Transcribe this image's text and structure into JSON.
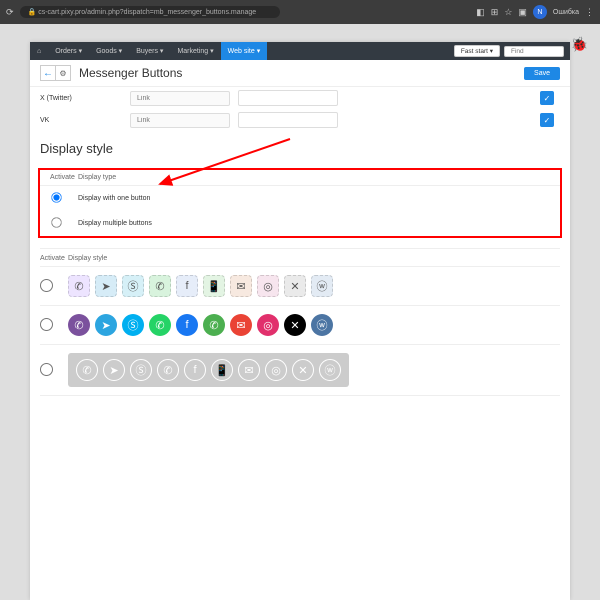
{
  "browser": {
    "url": "cs-cart.pixy.pro/admin.php?dispatch=mb_messenger_buttons.manage",
    "right_label": "Ошибка",
    "badge": "N"
  },
  "nav": {
    "items": [
      "Orders ▾",
      "Goods ▾",
      "Buyers ▾",
      "Marketing ▾",
      "Web site ▾"
    ],
    "fast_start": "Fast start ▾",
    "search_placeholder": "Find"
  },
  "header": {
    "title": "Messenger Buttons",
    "save": "Save"
  },
  "rows": [
    {
      "label": "X (Twitter)",
      "placeholder": "Link"
    },
    {
      "label": "VK",
      "placeholder": "Link"
    }
  ],
  "section": "Display style",
  "tbl": {
    "col1": "Activate",
    "col2": "Display type"
  },
  "options": [
    {
      "label": "Display with one button",
      "checked": true
    },
    {
      "label": "Display multiple buttons",
      "checked": false
    }
  ],
  "style_tbl": {
    "col1": "Activate",
    "col2": "Display style"
  },
  "icon_row1": [
    {
      "bg": "#ede4ff",
      "sym": "✆"
    },
    {
      "bg": "#d6ecf7",
      "sym": "➤"
    },
    {
      "bg": "#d6f0f7",
      "sym": "Ⓢ"
    },
    {
      "bg": "#d8f3dd",
      "sym": "✆"
    },
    {
      "bg": "#e6edf9",
      "sym": "f"
    },
    {
      "bg": "#e3f4e3",
      "sym": "📱"
    },
    {
      "bg": "#f7e9e0",
      "sym": "✉"
    },
    {
      "bg": "#f7e5ee",
      "sym": "◎"
    },
    {
      "bg": "#eaeaea",
      "sym": "✕"
    },
    {
      "bg": "#e3ebf4",
      "sym": "ⓦ"
    }
  ],
  "icon_row2": [
    {
      "bg": "#7b519d",
      "sym": "✆"
    },
    {
      "bg": "#2ca5e0",
      "sym": "➤"
    },
    {
      "bg": "#00aff0",
      "sym": "Ⓢ"
    },
    {
      "bg": "#25d366",
      "sym": "✆"
    },
    {
      "bg": "#1877f2",
      "sym": "f"
    },
    {
      "bg": "#4caf50",
      "sym": "✆"
    },
    {
      "bg": "#ea4335",
      "sym": "✉"
    },
    {
      "bg": "#e1306c",
      "sym": "◎"
    },
    {
      "bg": "#000000",
      "sym": "✕"
    },
    {
      "bg": "#4c75a3",
      "sym": "ⓦ"
    }
  ],
  "icon_row3": [
    "✆",
    "➤",
    "Ⓢ",
    "✆",
    "f",
    "📱",
    "✉",
    "◎",
    "✕",
    "ⓦ"
  ]
}
